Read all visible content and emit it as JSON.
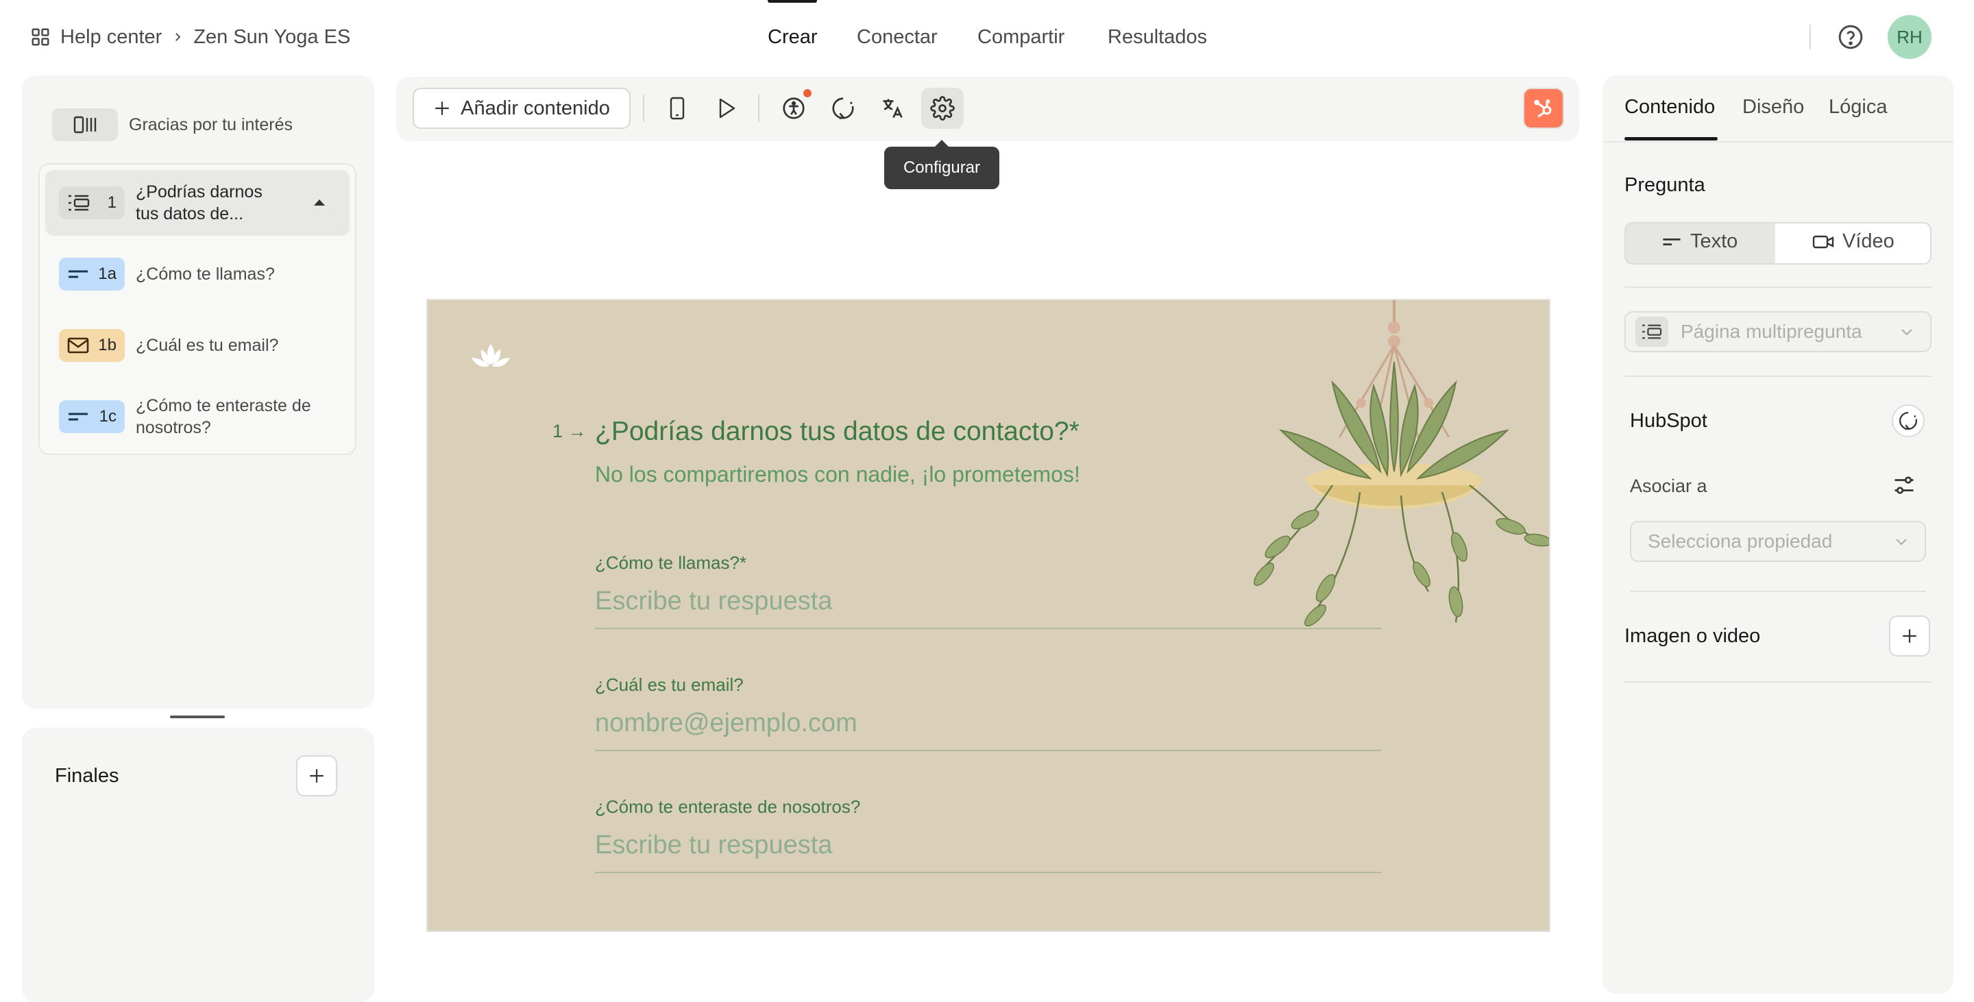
{
  "breadcrumb": {
    "root": "Help center",
    "current": "Zen Sun Yoga ES"
  },
  "nav": {
    "tabs": [
      "Crear",
      "Conectar",
      "Compartir",
      "Resultados"
    ],
    "active": "Crear"
  },
  "user": {
    "initials": "RH"
  },
  "sidebar": {
    "welcome_label": "Gracias por tu interés",
    "group": {
      "number": "1",
      "title": "¿Podrías darnos tus datos de..."
    },
    "questions": [
      {
        "badge": "1a",
        "icon": "short-text-icon",
        "label": "¿Cómo te llamas?",
        "color": "#bfdcfb"
      },
      {
        "badge": "1b",
        "icon": "mail-icon",
        "label": "¿Cuál es tu email?",
        "color": "#f6d9a8"
      },
      {
        "badge": "1c",
        "icon": "short-text-icon",
        "label": "¿Cómo te enteraste de nosotros?",
        "color": "#bfdcfb"
      }
    ],
    "endings_label": "Finales"
  },
  "toolbar": {
    "add_content": "Añadir contenido",
    "tooltip": "Configurar"
  },
  "form": {
    "number": "1",
    "title": "¿Podrías darnos tus datos de contacto?*",
    "subtitle": "No los compartiremos con nadie, ¡lo prometemos!",
    "fields": [
      {
        "label": "¿Cómo te llamas?*",
        "placeholder": "Escribe tu respuesta"
      },
      {
        "label": "¿Cuál es tu email?",
        "placeholder": "nombre@ejemplo.com"
      },
      {
        "label": "¿Cómo te enteraste de nosotros?",
        "placeholder": "Escribe tu respuesta"
      }
    ],
    "colors": {
      "background": "#dacfb8",
      "text": "#3d7a46"
    }
  },
  "panel": {
    "tabs": [
      "Contenido",
      "Diseño",
      "Lógica"
    ],
    "question_heading": "Pregunta",
    "mode_text": "Texto",
    "mode_video": "Vídeo",
    "question_type": "Página multipregunta",
    "hubspot_heading": "HubSpot",
    "associate_label": "Asociar a",
    "property_placeholder": "Selecciona propiedad",
    "media_heading": "Imagen o video"
  }
}
